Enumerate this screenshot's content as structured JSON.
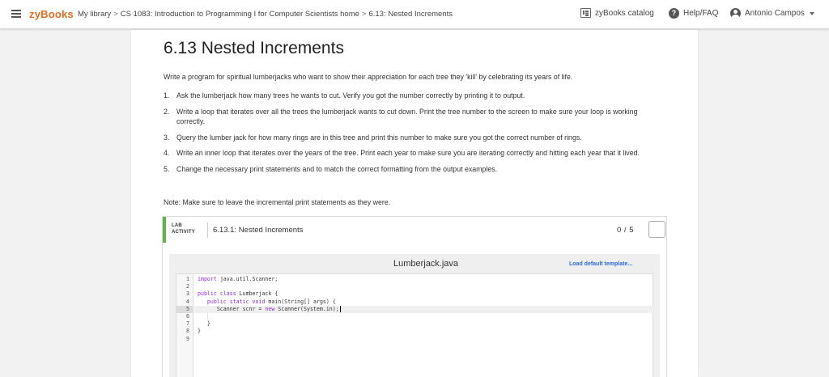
{
  "topbar": {
    "brand": "zyBooks",
    "breadcrumb": [
      "My library",
      "CS 1083: Introduction to Programming I for Computer Scientists home",
      "6.13: Nested Increments"
    ],
    "breadcrumb_separator": ">",
    "catalog_label": "zyBooks catalog",
    "help_label": "Help/FAQ",
    "user_name": "Antonio Campos",
    "brand_color": "#e26c1f"
  },
  "section": {
    "title": "6.13 Nested Increments",
    "intro": "Write a program for spiritual lumberjacks who want to show their appreciation for each tree they 'kill' by celebrating its years of life.",
    "steps": [
      {
        "num": "1.",
        "text": "Ask the lumberjack how many trees he wants to cut. Verify you got the number correctly by printing it to output."
      },
      {
        "num": "2.",
        "text": "Write a loop that iterates over all the trees the lumberjack wants to cut down. Print the tree number to the screen to make sure your loop is working correctly."
      },
      {
        "num": "3.",
        "text": "Query the lumber jack for how many rings are in this tree and print this number to make sure you got the correct number of rings."
      },
      {
        "num": "4.",
        "text": "Write an inner loop that iterates over the years of the tree. Print each year to make sure you are iterating correctly and hitting each year that it lived."
      },
      {
        "num": "5.",
        "text": "Change the necessary print statements and to match the correct formatting from the output examples."
      }
    ],
    "note": "Note: Make sure to leave the incremental print statements as they were."
  },
  "lab": {
    "tag_line1": "LAB",
    "tag_line2": "ACTIVITY",
    "title": "6.13.1: Nested Increments",
    "score": "0 / 5",
    "accent_color": "#5fb44b",
    "file_name": "Lumberjack.java",
    "load_template_label": "Load default template...",
    "code_lines": [
      {
        "n": "1",
        "text": "import java.util.Scanner;"
      },
      {
        "n": "2",
        "text": ""
      },
      {
        "n": "3",
        "text": "public class Lumberjack {"
      },
      {
        "n": "4",
        "text": "   public static void main(String[] args) {"
      },
      {
        "n": "5",
        "text": "      Scanner scnr = new Scanner(System.in);"
      },
      {
        "n": "6",
        "text": ""
      },
      {
        "n": "7",
        "text": "   }"
      },
      {
        "n": "8",
        "text": "}"
      },
      {
        "n": "9",
        "text": ""
      }
    ],
    "active_line": 5
  }
}
